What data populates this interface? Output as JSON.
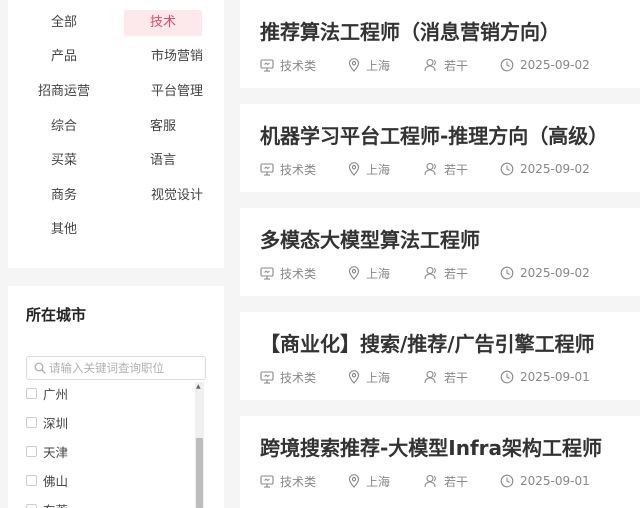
{
  "categories": [
    "全部",
    "技术",
    "产品",
    "市场营销",
    "招商运营",
    "平台管理",
    "综合",
    "客服",
    "买菜",
    "语言",
    "商务",
    "视觉设计",
    "其他"
  ],
  "active_category": "技术",
  "city_filter": {
    "title": "所在城市",
    "search_placeholder": "请输入关键词查询职位",
    "cities": [
      "广州",
      "深圳",
      "天津",
      "佛山",
      "东莞"
    ]
  },
  "jobs": [
    {
      "title": "推荐算法工程师（消息营销方向）",
      "category": "技术类",
      "city": "上海",
      "headcount": "若干",
      "date": "2025-09-02"
    },
    {
      "title": "机器学习平台工程师-推理方向（高级）",
      "category": "技术类",
      "city": "上海",
      "headcount": "若干",
      "date": "2025-09-02"
    },
    {
      "title": "多模态大模型算法工程师",
      "category": "技术类",
      "city": "上海",
      "headcount": "若干",
      "date": "2025-09-02"
    },
    {
      "title": "【商业化】搜索/推荐/广告引擎工程师",
      "category": "技术类",
      "city": "上海",
      "headcount": "若干",
      "date": "2025-09-01"
    },
    {
      "title": "跨境搜索推荐-大模型Infra架构工程师",
      "category": "技术类",
      "city": "上海",
      "headcount": "若干",
      "date": "2025-09-01"
    }
  ],
  "colors": {
    "accent": "#e24a65",
    "accent_bg": "#fde8ec"
  }
}
